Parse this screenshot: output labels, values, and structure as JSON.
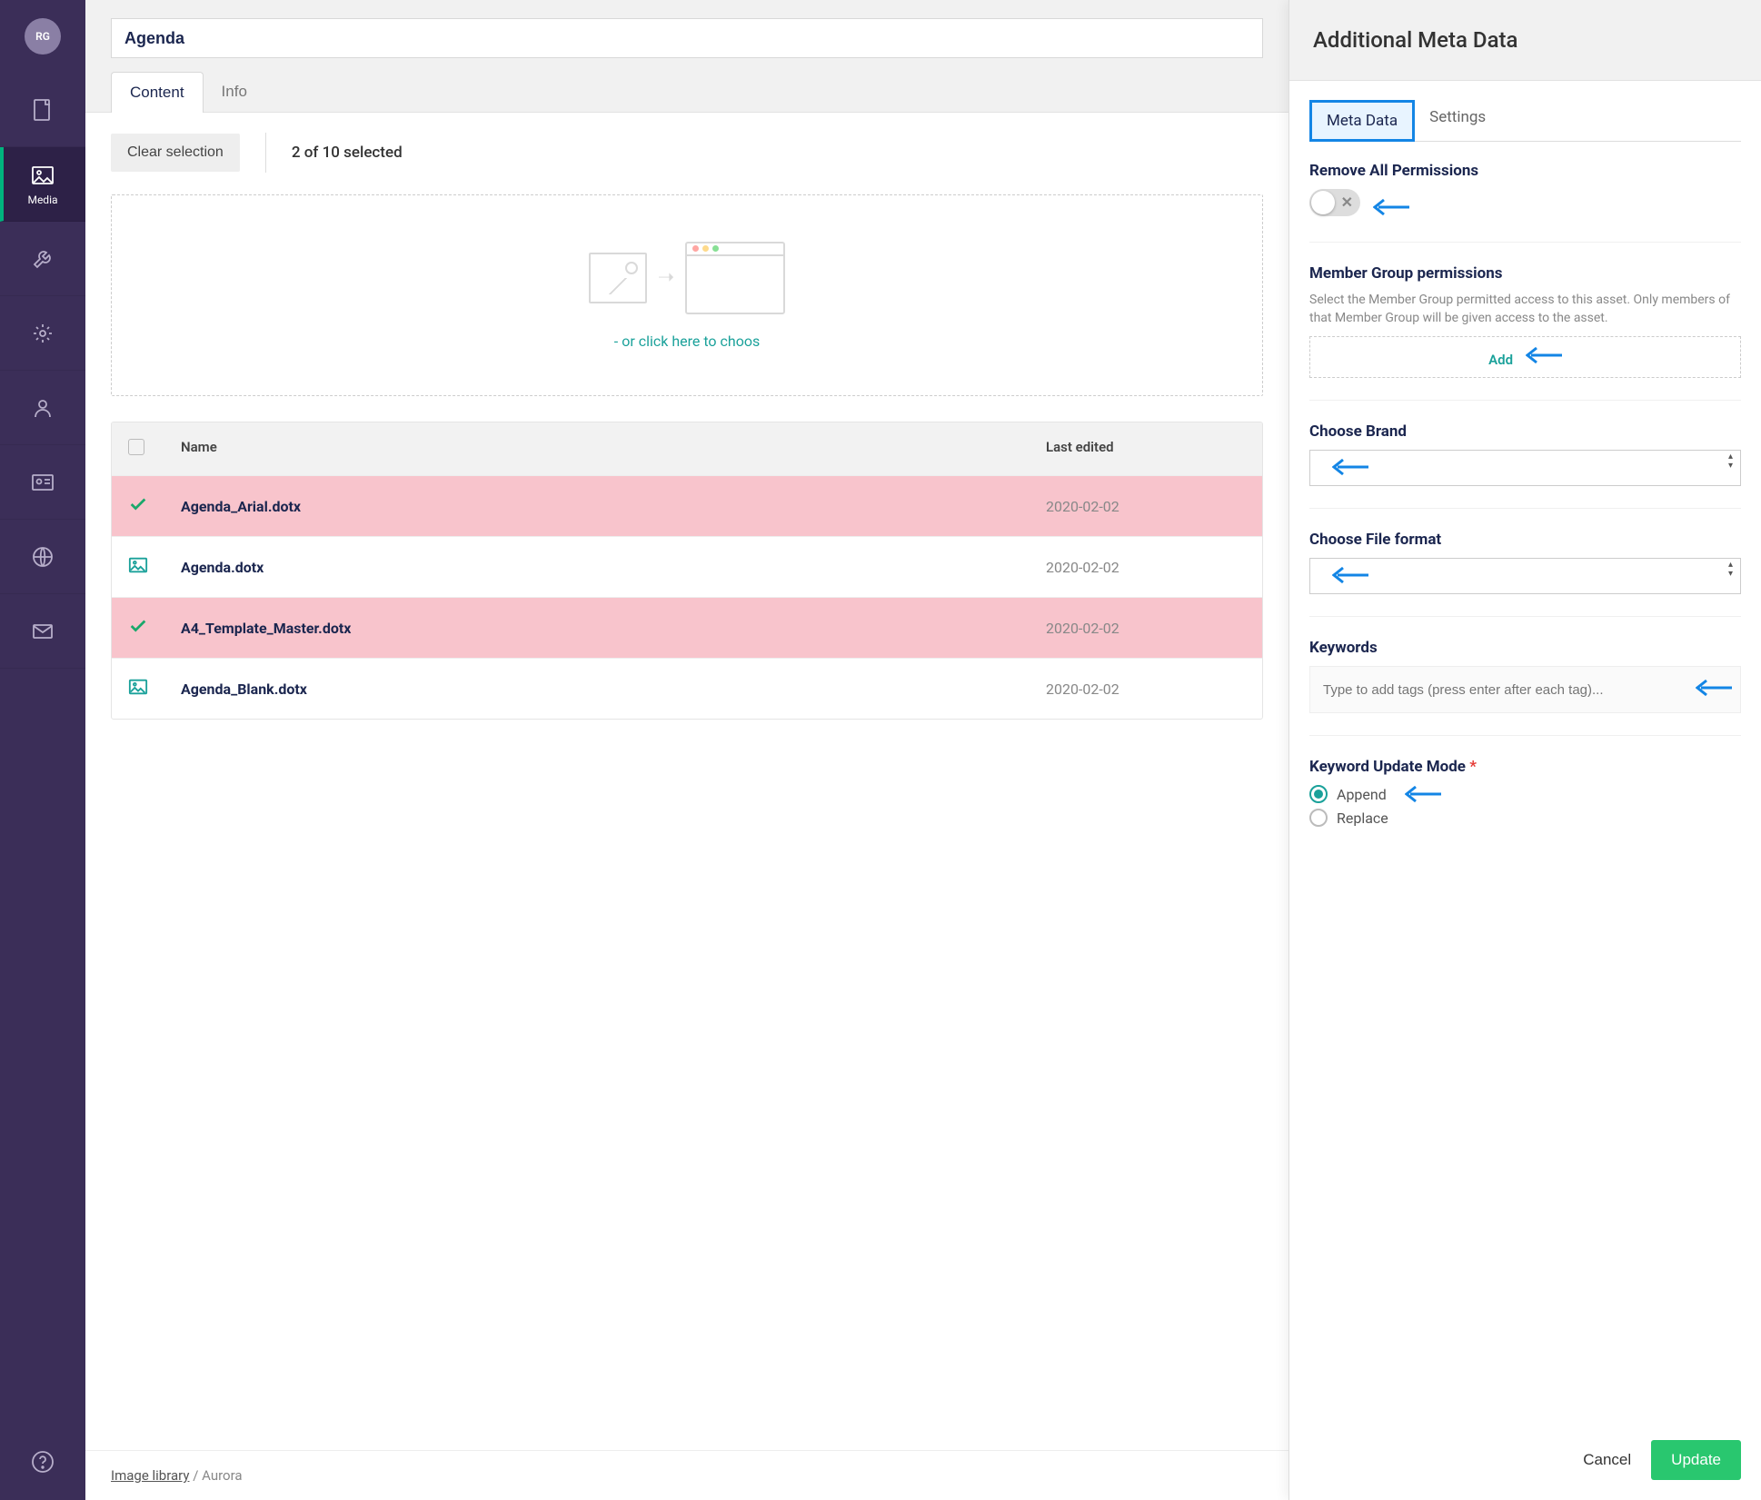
{
  "sidebar": {
    "avatar_initials": "RG",
    "items": [
      {
        "id": "content",
        "label": ""
      },
      {
        "id": "media",
        "label": "Media"
      },
      {
        "id": "tools",
        "label": ""
      },
      {
        "id": "settings",
        "label": ""
      },
      {
        "id": "users",
        "label": ""
      },
      {
        "id": "members",
        "label": ""
      },
      {
        "id": "globe",
        "label": ""
      },
      {
        "id": "mail",
        "label": ""
      }
    ]
  },
  "header": {
    "title_value": "Agenda",
    "tabs": [
      {
        "label": "Content",
        "active": true
      },
      {
        "label": "Info",
        "active": false
      }
    ]
  },
  "actions": {
    "clear_label": "Clear selection",
    "selection_text": "2 of 10 selected"
  },
  "dropzone": {
    "prompt": "- or click here to choos",
    "traffic": [
      "#ff5f57",
      "#febc2e",
      "#28c840"
    ]
  },
  "grid": {
    "headers": {
      "name": "Name",
      "last_edited": "Last edited"
    },
    "rows": [
      {
        "name": "Agenda_Arial.dotx",
        "last_edited": "2020-02-02",
        "selected": true
      },
      {
        "name": "Agenda.dotx",
        "last_edited": "2020-02-02",
        "selected": false
      },
      {
        "name": "A4_Template_Master.dotx",
        "last_edited": "2020-02-02",
        "selected": true
      },
      {
        "name": "Agenda_Blank.dotx",
        "last_edited": "2020-02-02",
        "selected": false
      }
    ]
  },
  "breadcrumb": {
    "root": "Image library",
    "current": "Aurora"
  },
  "panel": {
    "title": "Additional Meta Data",
    "tabs": [
      {
        "label": "Meta Data",
        "active": true
      },
      {
        "label": "Settings",
        "active": false
      }
    ],
    "remove_permissions": {
      "label": "Remove All Permissions",
      "value": false
    },
    "member_group": {
      "label": "Member Group permissions",
      "description": "Select the Member Group permitted access to this asset. Only members of that Member Group will be given access to the asset.",
      "add_label": "Add"
    },
    "brand": {
      "label": "Choose Brand",
      "value": ""
    },
    "file_format": {
      "label": "Choose File format",
      "value": ""
    },
    "keywords": {
      "label": "Keywords",
      "placeholder": "Type to add tags (press enter after each tag)..."
    },
    "keyword_mode": {
      "label": "Keyword Update Mode",
      "options": [
        {
          "label": "Append",
          "checked": true
        },
        {
          "label": "Replace",
          "checked": false
        }
      ]
    },
    "footer": {
      "cancel": "Cancel",
      "update": "Update"
    }
  }
}
